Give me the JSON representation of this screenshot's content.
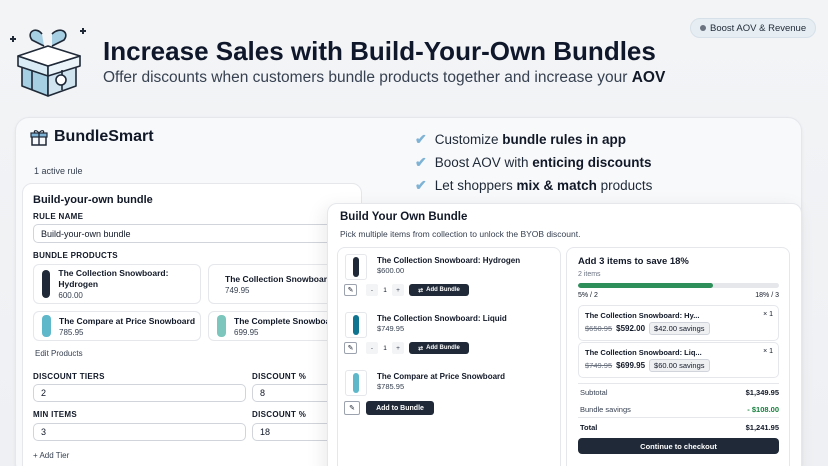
{
  "header": {
    "badge": "Boost AOV & Revenue",
    "title": "Increase Sales with Build-Your-Own Bundles",
    "subtitle_prefix": "Offer discounts when customers bundle products together and increase your ",
    "subtitle_emph": "AOV"
  },
  "app": {
    "name": "BundleSmart",
    "active_rules": "1 active rule"
  },
  "features": [
    {
      "prefix": "Customize ",
      "emph": "bundle rules in app",
      "suffix": ""
    },
    {
      "prefix": "Boost AOV with ",
      "emph": "enticing discounts",
      "suffix": ""
    },
    {
      "prefix": "Let shoppers ",
      "emph": "mix & match",
      "suffix": " products"
    }
  ],
  "builder": {
    "title": "Build-your-own bundle",
    "rule_name_label": "RULE NAME",
    "rule_name_value": "Build-your-own bundle",
    "bundle_products_label": "BUNDLE PRODUCTS",
    "products": [
      {
        "name": "The Collection Snowboard: Hydrogen",
        "price": "600.00",
        "color": "#1f2937"
      },
      {
        "name": "The Collection Snowboard: Liquid",
        "price": "749.95",
        "color": "#0e7490"
      },
      {
        "name": "The Compare at Price Snowboard",
        "price": "785.95",
        "color": "#5eb8c9"
      },
      {
        "name": "The Complete Snowboard",
        "price": "699.95",
        "color": "#7dc6bd"
      }
    ],
    "edit_products": "Edit Products",
    "discount_tiers_label": "DISCOUNT TIERS",
    "discount_pct_label": "DISCOUNT %",
    "min_items_label": "MIN ITEMS",
    "tiers": [
      {
        "value": "2",
        "discount": "8"
      },
      {
        "value": "3",
        "discount": "18"
      }
    ],
    "add_tier": "+ Add Tier"
  },
  "bundle": {
    "title": "Build Your Own Bundle",
    "subtitle": "Pick multiple items from collection to unlock the BYOB discount.",
    "items": [
      {
        "name": "The Collection Snowboard: Hydrogen",
        "price": "$600.00",
        "qty": "1",
        "button": "Add Bundle",
        "color": "#1f2937"
      },
      {
        "name": "The Collection Snowboard: Liquid",
        "price": "$749.95",
        "qty": "1",
        "button": "Add Bundle",
        "color": "#0e7490"
      },
      {
        "name": "The Compare at Price Snowboard",
        "price": "$785.95",
        "button": "Add to Bundle",
        "color": "#5eb8c9"
      }
    ]
  },
  "summary": {
    "title": "Add 3 items to save 18%",
    "count": "2 items",
    "progress": 0.67,
    "tier_low": "5% / 2",
    "tier_high": "18% / 3",
    "items": [
      {
        "name": "The Collection Snowboard: Hy...",
        "qty": "× 1",
        "old": "$650.95",
        "new": "$592.00",
        "savings": "$42.00 savings"
      },
      {
        "name": "The Collection Snowboard: Liq...",
        "qty": "× 1",
        "old": "$749.95",
        "new": "$699.95",
        "savings": "$60.00 savings"
      }
    ],
    "subtotal_label": "Subtotal",
    "subtotal": "$1,349.95",
    "savings_label": "Bundle savings",
    "savings": "- $108.00",
    "total_label": "Total",
    "total": "$1,241.95",
    "checkout": "Continue to checkout"
  },
  "colors": {
    "accent": "#1f2937",
    "progress": "#2f8f5b",
    "check": "#7fb3d5"
  },
  "icons": [
    "gift-box-icon",
    "snowboard-logo-icon",
    "check-icon",
    "edit-icon",
    "bundle-icon"
  ]
}
